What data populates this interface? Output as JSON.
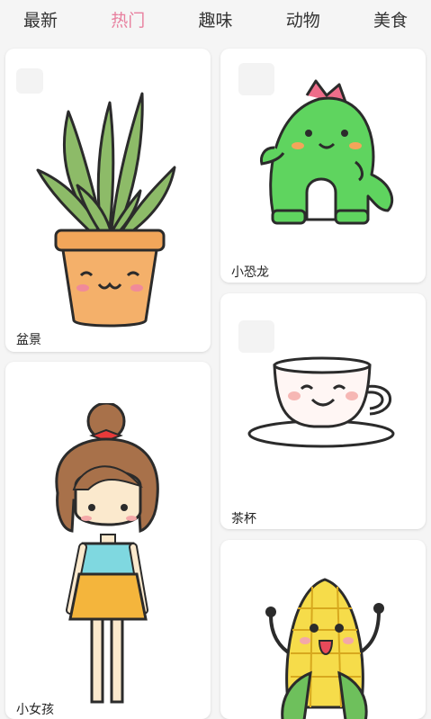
{
  "tabs": [
    {
      "label": "最新"
    },
    {
      "label": "热门"
    },
    {
      "label": "趣味"
    },
    {
      "label": "动物"
    },
    {
      "label": "美食"
    }
  ],
  "colors": {
    "active_tab": "#e8809f",
    "tab_text": "#333333",
    "card_bg": "#ffffff",
    "page_bg": "#f5f5f5"
  },
  "cards": [
    {
      "label": "盆景",
      "icon": "potted-succulent-drawing"
    },
    {
      "label": "小恐龙",
      "icon": "green-dinosaur-drawing"
    },
    {
      "label": "茶杯",
      "icon": "teacup-drawing"
    },
    {
      "label": "小女孩",
      "icon": "little-girl-drawing"
    },
    {
      "label": "",
      "icon": "corn-drawing"
    }
  ]
}
